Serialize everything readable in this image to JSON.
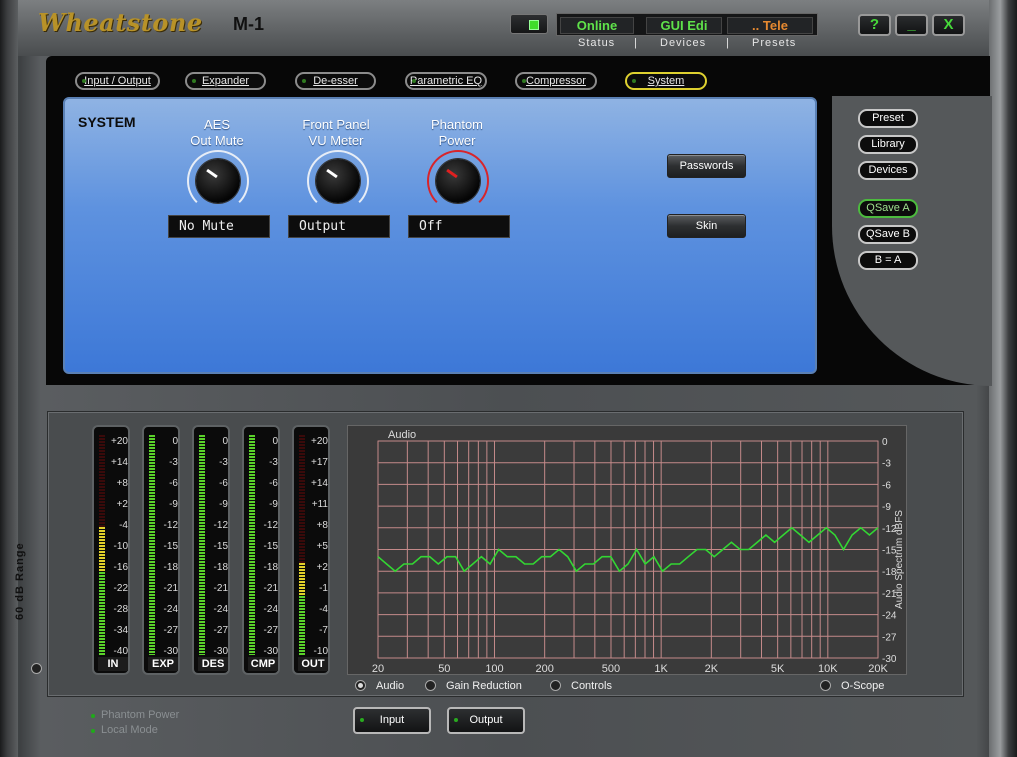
{
  "app": {
    "brand": "Wheatstone",
    "model": "M-1"
  },
  "status": {
    "online": "Online",
    "gui": "GUI Edi",
    "tele": ".. Tele",
    "labels": [
      "Status",
      "|",
      "Devices",
      "|",
      "Presets"
    ]
  },
  "window_buttons": {
    "help": "?",
    "minimize": "_",
    "close": "X"
  },
  "tabs": [
    "Input / Output",
    "Expander",
    "De-esser",
    "Parametric EQ",
    "Compressor",
    "System"
  ],
  "active_tab": "System",
  "system": {
    "title": "SYSTEM",
    "knobs": [
      {
        "label_line1": "AES",
        "label_line2": "Out Mute",
        "value": "No Mute"
      },
      {
        "label_line1": "Front Panel",
        "label_line2": "VU Meter",
        "value": "Output"
      },
      {
        "label_line1": "Phantom",
        "label_line2": "Power",
        "value": "Off"
      }
    ],
    "buttons": {
      "passwords": "Passwords",
      "skin": "Skin"
    }
  },
  "side_buttons": [
    "Preset",
    "Library",
    "Devices",
    "QSave A",
    "QSave B",
    "B = A"
  ],
  "meters": [
    {
      "label": "IN",
      "ticks": [
        "+20",
        "+14",
        "+8",
        "+2",
        "-4",
        "-10",
        "-16",
        "-22",
        "-28",
        "-34",
        "-40"
      ],
      "level": 0.58
    },
    {
      "label": "EXP",
      "ticks": [
        "0",
        "-3",
        "-6",
        "-9",
        "-12",
        "-15",
        "-18",
        "-21",
        "-24",
        "-27",
        "-30"
      ],
      "level": 1.0
    },
    {
      "label": "DES",
      "ticks": [
        "0",
        "-3",
        "-6",
        "-9",
        "-12",
        "-15",
        "-18",
        "-21",
        "-24",
        "-27",
        "-30"
      ],
      "level": 1.0
    },
    {
      "label": "CMP",
      "ticks": [
        "0",
        "-3",
        "-6",
        "-9",
        "-12",
        "-15",
        "-18",
        "-21",
        "-24",
        "-27",
        "-30"
      ],
      "level": 1.0
    },
    {
      "label": "OUT",
      "ticks": [
        "+20",
        "+17",
        "+14",
        "+11",
        "+8",
        "+5",
        "+2",
        "-1",
        "-4",
        "-7",
        "-10"
      ],
      "level": 0.42
    }
  ],
  "range_label": "60 dB Range",
  "spectrum": {
    "title": "Audio",
    "x_ticks": [
      "20",
      "50",
      "100",
      "200",
      "500",
      "1K",
      "2K",
      "5K",
      "10K",
      "20K"
    ],
    "y_ticks": [
      "0",
      "-3",
      "-6",
      "-9",
      "-12",
      "-15",
      "-18",
      "-21",
      "-24",
      "-27",
      "-30"
    ],
    "ylabel": "Audio Spectrum dBFS",
    "line_color": "#33d633",
    "curve_db": [
      -16,
      -17,
      -18,
      -17,
      -17,
      -16,
      -16,
      -17,
      -16,
      -16,
      -18,
      -17,
      -16,
      -17,
      -15,
      -16,
      -16,
      -17,
      -17,
      -16,
      -16,
      -15,
      -16,
      -18,
      -17,
      -17,
      -16,
      -16,
      -18,
      -17,
      -15,
      -17,
      -16,
      -18,
      -17,
      -17,
      -16,
      -15,
      -15,
      -16,
      -15,
      -14,
      -15,
      -15,
      -14,
      -13,
      -14,
      -13,
      -12,
      -13,
      -14,
      -13,
      -12,
      -13,
      -15,
      -13,
      -12,
      -13,
      -12
    ]
  },
  "view_options": [
    {
      "label": "Audio",
      "selected": true
    },
    {
      "label": "Gain Reduction",
      "selected": false
    },
    {
      "label": "Controls",
      "selected": false
    },
    {
      "label": "O-Scope",
      "selected": false
    }
  ],
  "footer": {
    "leds": [
      "Phantom Power",
      "Local Mode"
    ],
    "input_button": "Input",
    "output_button": "Output"
  }
}
